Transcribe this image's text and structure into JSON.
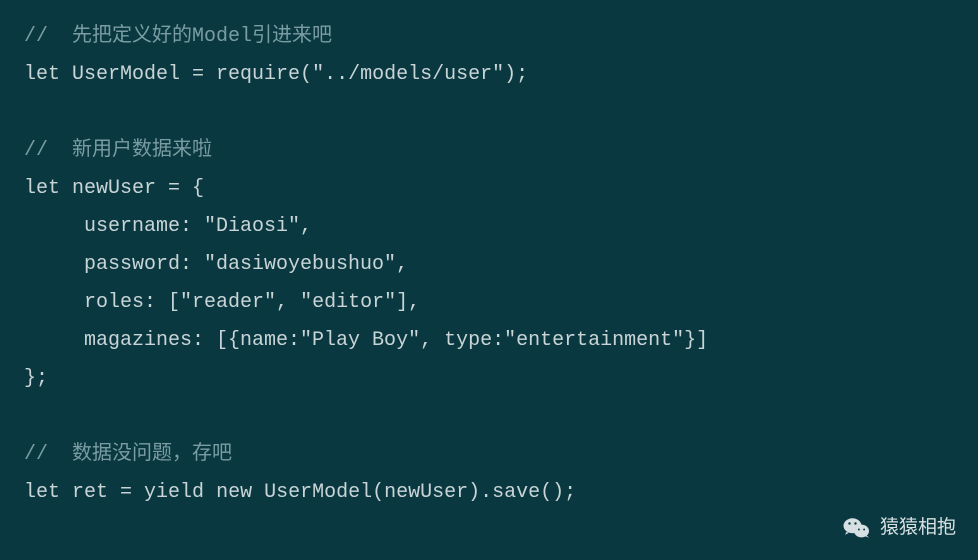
{
  "code": {
    "comment1": "//  先把定义好的Model引进来吧",
    "line2_let": "let",
    "line2_var": " UserModel = require(",
    "line2_str": "\"../models/user\"",
    "line2_end": ");",
    "comment2": "//  新用户数据来啦",
    "line5_let": "let",
    "line5_rest": " newUser = {",
    "line6_key": "     username: ",
    "line6_str": "\"Diaosi\"",
    "line6_end": ",",
    "line7_key": "     password: ",
    "line7_str": "\"dasiwoyebushuo\"",
    "line7_end": ",",
    "line8_key": "     roles: [",
    "line8_str1": "\"reader\"",
    "line8_mid": ", ",
    "line8_str2": "\"editor\"",
    "line8_end": "],",
    "line9_key": "     magazines: [{name:",
    "line9_str1": "\"Play Boy\"",
    "line9_mid": ", type:",
    "line9_str2": "\"entertainment\"",
    "line9_end": "}]",
    "line10": "};",
    "comment3": "//  数据没问题，存吧",
    "line13_let": "let",
    "line13_a": " ret = ",
    "line13_yield": "yield",
    "line13_b": " ",
    "line13_new": "new",
    "line13_c": " UserModel(newUser).save();"
  },
  "watermark": {
    "text": "猿猿相抱",
    "icon": "wechat-icon"
  },
  "chart_data": {
    "type": "table",
    "title": "JavaScript code snippet",
    "lines": [
      "//  先把定义好的Model引进来吧",
      "let UserModel = require(\"../models/user\");",
      "",
      "//  新用户数据来啦",
      "let newUser = {",
      "     username: \"Diaosi\",",
      "     password: \"dasiwoyebushuo\",",
      "     roles: [\"reader\", \"editor\"],",
      "     magazines: [{name:\"Play Boy\", type:\"entertainment\"}]",
      "};",
      "",
      "//  数据没问题，存吧",
      "let ret = yield new UserModel(newUser).save();"
    ]
  }
}
